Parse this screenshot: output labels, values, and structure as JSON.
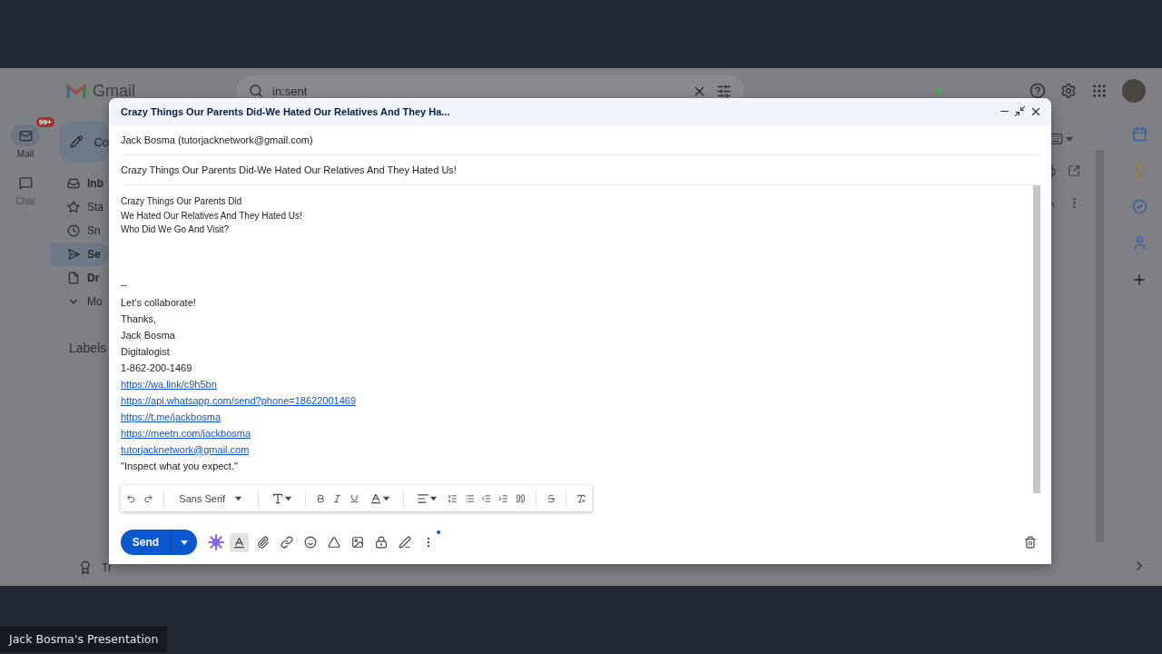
{
  "presentation_label": "Jack Bosma's Presentation",
  "gmail": {
    "logo_text": "Gmail",
    "search": {
      "value": "in:sent"
    },
    "rail": [
      {
        "kind": "mail",
        "label": "Mail",
        "badge": "99+",
        "selected": true
      },
      {
        "kind": "chat",
        "label": "Chat",
        "selected": false
      }
    ],
    "compose_button": "Co",
    "nav": [
      {
        "kind": "inbox",
        "label": "Inb",
        "unread": true,
        "selected": false
      },
      {
        "kind": "starred",
        "label": "Sta",
        "unread": false,
        "selected": false
      },
      {
        "kind": "snoozed",
        "label": "Sn",
        "unread": false,
        "selected": false
      },
      {
        "kind": "sent",
        "label": "Se",
        "unread": true,
        "selected": true
      },
      {
        "kind": "drafts",
        "label": "Dr",
        "unread": true,
        "selected": false
      },
      {
        "kind": "more",
        "label": "Mo",
        "unread": false,
        "selected": false
      }
    ],
    "labels_heading": "Labels",
    "footer": "Tr"
  },
  "compose": {
    "title": "Crazy Things Our Parents Did-We Hated Our Relatives And They Ha...",
    "from": "Jack Bosma (tutorjacknetwork@gmail.com)",
    "subject": "Crazy Things Our Parents Did-We Hated Our Relatives And They Hated Us!",
    "message_lines": [
      "Crazy Things Our Parents Did",
      "We Hated Our Relatives And They Hated Us!",
      "Who Did We Go And Visit?"
    ],
    "signature_separator": "--",
    "signature": [
      {
        "kind": "text",
        "text": "Let's collaborate!"
      },
      {
        "kind": "text",
        "text": "Thanks,"
      },
      {
        "kind": "text",
        "text": "Jack Bosma"
      },
      {
        "kind": "text",
        "text": "Digitalogist"
      },
      {
        "kind": "text",
        "text": "1-862-200-1469"
      },
      {
        "kind": "link",
        "text": "https://wa.link/c9h5bn"
      },
      {
        "kind": "link",
        "text": "https://api.whatsapp.com/send?phone=18622001469"
      },
      {
        "kind": "link",
        "text": "https://t.me/jackbosma"
      },
      {
        "kind": "link",
        "text": "https://meetn.com/jackbosma"
      },
      {
        "kind": "link",
        "text": "tutorjacknetwork@gmail.com"
      },
      {
        "kind": "text",
        "text": "\"Inspect what you expect.\""
      }
    ],
    "font": "Sans Serif",
    "formatting_on": true,
    "send": "Send"
  }
}
